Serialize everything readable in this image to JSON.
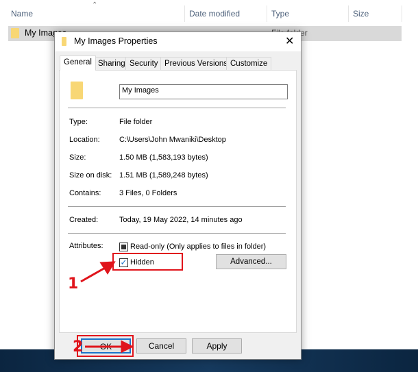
{
  "explorer": {
    "columns": [
      "Name",
      "Date modified",
      "Type",
      "Size"
    ],
    "row_name": "My Images",
    "row_type": "File folder"
  },
  "dialog": {
    "title": "My Images Properties",
    "tabs": [
      "General",
      "Sharing",
      "Security",
      "Previous Versions",
      "Customize"
    ],
    "active_tab": "General",
    "name_value": "My Images",
    "fields": [
      {
        "label": "Type:",
        "value": "File folder"
      },
      {
        "label": "Location:",
        "value": "C:\\Users\\John Mwaniki\\Desktop"
      },
      {
        "label": "Size:",
        "value": "1.50 MB (1,583,193 bytes)"
      },
      {
        "label": "Size on disk:",
        "value": "1.51 MB (1,589,248 bytes)"
      },
      {
        "label": "Contains:",
        "value": "3 Files, 0 Folders"
      }
    ],
    "created": {
      "label": "Created:",
      "value": "Today, 19 May 2022, 14 minutes ago"
    },
    "attributes_label": "Attributes:",
    "readonly_label": "Read-only (Only applies to files in folder)",
    "readonly_state": "indeterminate",
    "hidden_label": "Hidden",
    "hidden_checked": true,
    "advanced_label": "Advanced...",
    "ok_label": "OK",
    "cancel_label": "Cancel",
    "apply_label": "Apply"
  },
  "annotations": {
    "step1": "1",
    "step2": "2",
    "color": "#e0141b"
  }
}
